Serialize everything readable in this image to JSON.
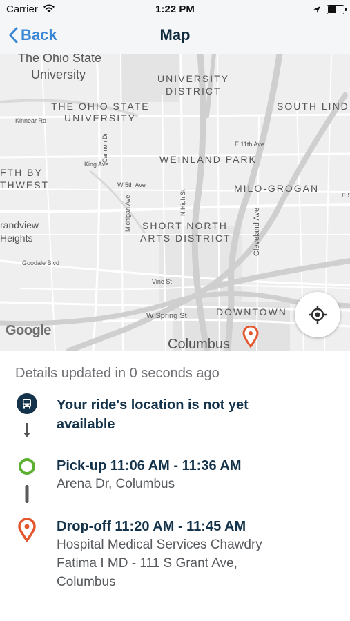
{
  "status_bar": {
    "carrier": "Carrier",
    "time": "1:22 PM"
  },
  "nav": {
    "back_label": "Back",
    "title": "Map"
  },
  "map": {
    "labels": {
      "ohio_state_top": "The Ohio State",
      "university_top": "University",
      "university_district": "UNIVERSITY",
      "university_district_2": "DISTRICT",
      "ohio_state_univ": "THE OHIO STATE",
      "ohio_state_univ_2": "UNIVERSITY",
      "south_lind": "SOUTH LIND",
      "kinnear": "Kinnear Rd",
      "e11": "E 11th Ave",
      "weinland": "WEINLAND PARK",
      "king": "King Ave",
      "fth_by": "FTH BY",
      "thwest": "THWEST",
      "w5th": "W 5th Ave",
      "milo": "MILO-GROGAN",
      "e5": "E 5",
      "randview": "randview",
      "heights": "Heights",
      "short_north": "SHORT NORTH",
      "arts_district": "ARTS DISTRICT",
      "goodale": "Goodale Blvd",
      "vine": "Vine St",
      "w_spring": "W Spring St",
      "downtown": "DOWNTOWN",
      "columbus": "Columbus",
      "cannon": "Cannon Dr",
      "michigan": "Michigan Ave",
      "n_high": "N High St",
      "cleveland": "Cleveland Ave"
    },
    "attribution": "Google",
    "locate_icon": "crosshair-icon"
  },
  "details": {
    "updated_text": "Details updated in 0 seconds ago",
    "ride": {
      "title_line1": "Your ride's location is not yet",
      "title_line2": "available",
      "icon": "bus-icon"
    },
    "pickup": {
      "title": "Pick-up 11:06 AM - 11:36 AM",
      "address": "Arena Dr, Columbus",
      "color": "#5bb030"
    },
    "dropoff": {
      "title": "Drop-off 11:20 AM - 11:45 AM",
      "address_line1": "Hospital Medical Services Chawdry",
      "address_line2": "Fatima I MD - 111 S Grant Ave,",
      "address_line3": "Columbus",
      "color": "#e4572e"
    }
  },
  "colors": {
    "accent": "#3a87d6",
    "title": "#0f2a3d",
    "navy": "#14334a"
  }
}
